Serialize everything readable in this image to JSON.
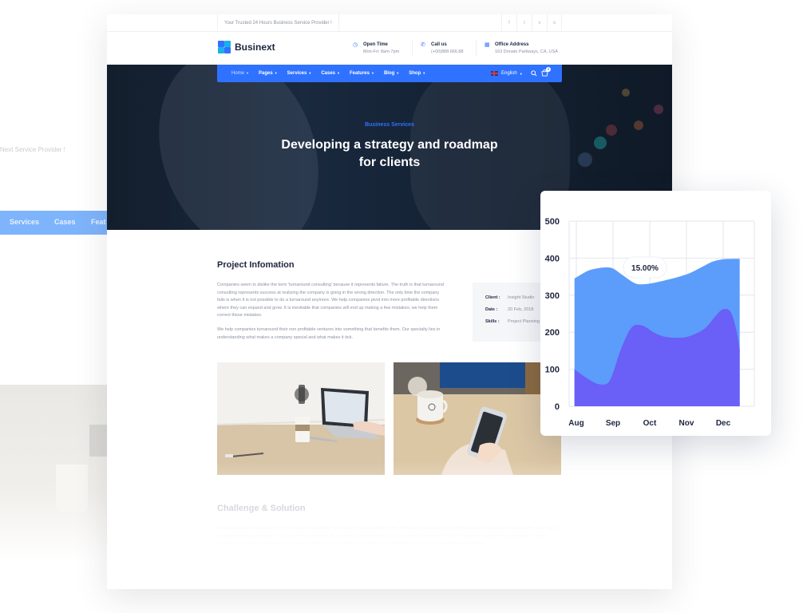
{
  "background": {
    "tagline_partial": "Next Service Provider !",
    "nav_items": [
      "Services",
      "Cases",
      "Feat"
    ]
  },
  "topbar": {
    "tagline": "Your Trusted 24 Hours Business Service Provider !",
    "social_icons": [
      "facebook-icon",
      "twitter-icon",
      "vimeo-icon",
      "instagram-icon"
    ],
    "social_glyphs": [
      "f",
      "t",
      "v",
      "o"
    ]
  },
  "header": {
    "brand": "Businext",
    "open_time": {
      "label": "Open Time",
      "value": "Mon-Fri: 8am-7pm"
    },
    "call_us": {
      "label": "Call us",
      "value": "(+00)888.666.88"
    },
    "office": {
      "label": "Office Address",
      "value": "163 Donato Parkways, CA, USA"
    }
  },
  "nav": {
    "items": [
      {
        "label": "Home",
        "active": true
      },
      {
        "label": "Pages",
        "active": false
      },
      {
        "label": "Services",
        "active": false
      },
      {
        "label": "Cases",
        "active": false
      },
      {
        "label": "Features",
        "active": false
      },
      {
        "label": "Blog",
        "active": false
      },
      {
        "label": "Shop",
        "active": false
      }
    ],
    "language": "English",
    "cart_count": "0"
  },
  "hero": {
    "kicker": "Business Services",
    "title_line1": "Developing a strategy and roadmap",
    "title_line2": "for clients"
  },
  "project": {
    "title": "Project Infomation",
    "para1": "Companies seem to dislike the term 'turnaround consulting' because it represents failure. The truth is that turnaround consulting represents success at realizing the company is going in the wrong direction. The only time the company fails is when it is not possible to do a turnaround anymore. We help companies pivot into more profitable directions where they can expand and grow. It is inevitable that companies will end up making a few mistakes; we help them correct these mistakes.",
    "para2": "We help companies turnaround their non profitable ventures into something that benefits them. Our specialty lies in understanding what makes a company special and what makes it tick.",
    "info": {
      "client_label": "Client :",
      "client_value": "Insight Studio",
      "date_label": "Date :",
      "date_value": "20 Feb, 2018",
      "skills_label": "Skills :",
      "skills_value": "Project Planning"
    }
  },
  "challenge": {
    "title": "Challenge & Solution",
    "text": "Companies seem to dislike the term 'turnaround consulting' because it represents failure. The truth is that turnaround consulting represents success at realizing the company is going in the wrong direction. The only time the company fails is when it is not possible to do a turnaround anymore. We help companies pivot into more profitable directions where they can expand and grow. It is inevitable that companies will end up making a few mistakes; we help them correct these mistakes."
  },
  "chart_data": {
    "type": "area",
    "categories": [
      "Aug",
      "Sep",
      "Oct",
      "Nov",
      "Dec"
    ],
    "ylim": [
      0,
      500
    ],
    "yticks": [
      0,
      100,
      200,
      300,
      400,
      500
    ],
    "tooltip": "15.00%",
    "series": [
      {
        "color": "#5c9dfb",
        "x": [
          -0.05,
          0.3,
          0.55,
          0.8,
          1.0,
          1.25,
          1.6,
          1.9,
          2.2,
          2.5,
          2.8,
          3.1,
          3.4,
          3.7,
          4.0,
          4.2,
          4.45
        ],
        "y": [
          345,
          365,
          372,
          375,
          372,
          355,
          332,
          330,
          335,
          342,
          350,
          360,
          375,
          390,
          397,
          398,
          398
        ]
      },
      {
        "color": "#6a5ff7",
        "x": [
          -0.05,
          0.3,
          0.6,
          0.85,
          1.0,
          1.2,
          1.5,
          1.8,
          2.1,
          2.4,
          2.8,
          3.1,
          3.5,
          3.8,
          4.0,
          4.2,
          4.35,
          4.45
        ],
        "y": [
          100,
          75,
          60,
          62,
          90,
          150,
          212,
          218,
          200,
          188,
          185,
          190,
          210,
          245,
          262,
          255,
          210,
          155
        ]
      }
    ]
  },
  "colors": {
    "accent": "#2f72ff",
    "heading": "#1e2540",
    "muted": "#8b92a0"
  }
}
